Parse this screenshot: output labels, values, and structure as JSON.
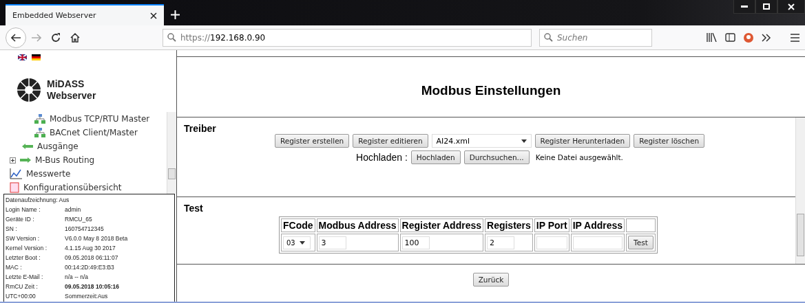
{
  "browser": {
    "tab_title": "Embedded Webserver",
    "url_scheme": "https://",
    "url_host": "192.168.0.90",
    "search_placeholder": "Suchen"
  },
  "sidebar": {
    "logo_line1": "MiDASS",
    "logo_line2": "Webserver",
    "nav": [
      {
        "children": [
          {
            "children": [
              {
                "label": "Modbus TCP/RTU Master",
                "kind": "network"
              },
              {
                "label": "BACnet Client/Master",
                "kind": "network"
              }
            ]
          },
          {
            "label": "Ausgänge",
            "kind": "out"
          }
        ]
      },
      {
        "label": "M-Bus Routing",
        "kind": "in",
        "expanded": false
      },
      {
        "label": "Messwerte",
        "kind": "chart"
      },
      {
        "label": "Konfigurationsübersicht",
        "kind": "doc"
      }
    ],
    "info": [
      {
        "kind": "full",
        "label": "Datenaufzeichnung: Aus"
      },
      {
        "kind": "plain",
        "label": "Login Name :",
        "value": "admin"
      },
      {
        "kind": "plain",
        "label": "Geräte ID :",
        "value": "RMCU_65"
      },
      {
        "kind": "plain",
        "label": "SN :",
        "value": "160754712345"
      },
      {
        "kind": "plain",
        "label": "SW Version :",
        "value": "V6.0.0 May 8 2018 Beta"
      },
      {
        "kind": "plain",
        "label": "Kernel Version :",
        "value": "4.1.15 Aug 30 2017"
      },
      {
        "kind": "plain",
        "label": "Letzter Boot :",
        "value": "09.05.2018 06:11:07"
      },
      {
        "kind": "plain",
        "label": "MAC :",
        "value": "00:14:2D:49:E3:B3"
      },
      {
        "kind": "plain",
        "label": "Letzte E-Mail :",
        "value": "n/a -- n/a"
      },
      {
        "kind": "strong",
        "label": "RmCU Zeit :",
        "value": "09.05.2018 10:05:16"
      },
      {
        "kind": "plain",
        "label": "UTC+00:00",
        "value": "Sommerzeit:Aus"
      }
    ]
  },
  "main": {
    "title": "Modbus Einstellungen",
    "driver": {
      "heading": "Treiber",
      "buttons_before": [
        "Register erstellen",
        "Register editieren"
      ],
      "file_select": "AI24.xml",
      "buttons_after": [
        "Register Herunterladen",
        "Register löschen"
      ],
      "upload_label": "Hochladen :",
      "upload_button": "Hochladen",
      "browse_button": "Durchsuchen...",
      "no_file": "Keine Datei ausgewählt."
    },
    "test": {
      "heading": "Test",
      "columns": [
        "FCode",
        "Modbus Address",
        "Register Address",
        "Registers",
        "IP Port",
        "IP Address"
      ],
      "fcode": "03",
      "modbus_address": "3",
      "register_address": "100",
      "registers": "2",
      "test_button": "Test"
    },
    "back_button": "Zurück"
  }
}
